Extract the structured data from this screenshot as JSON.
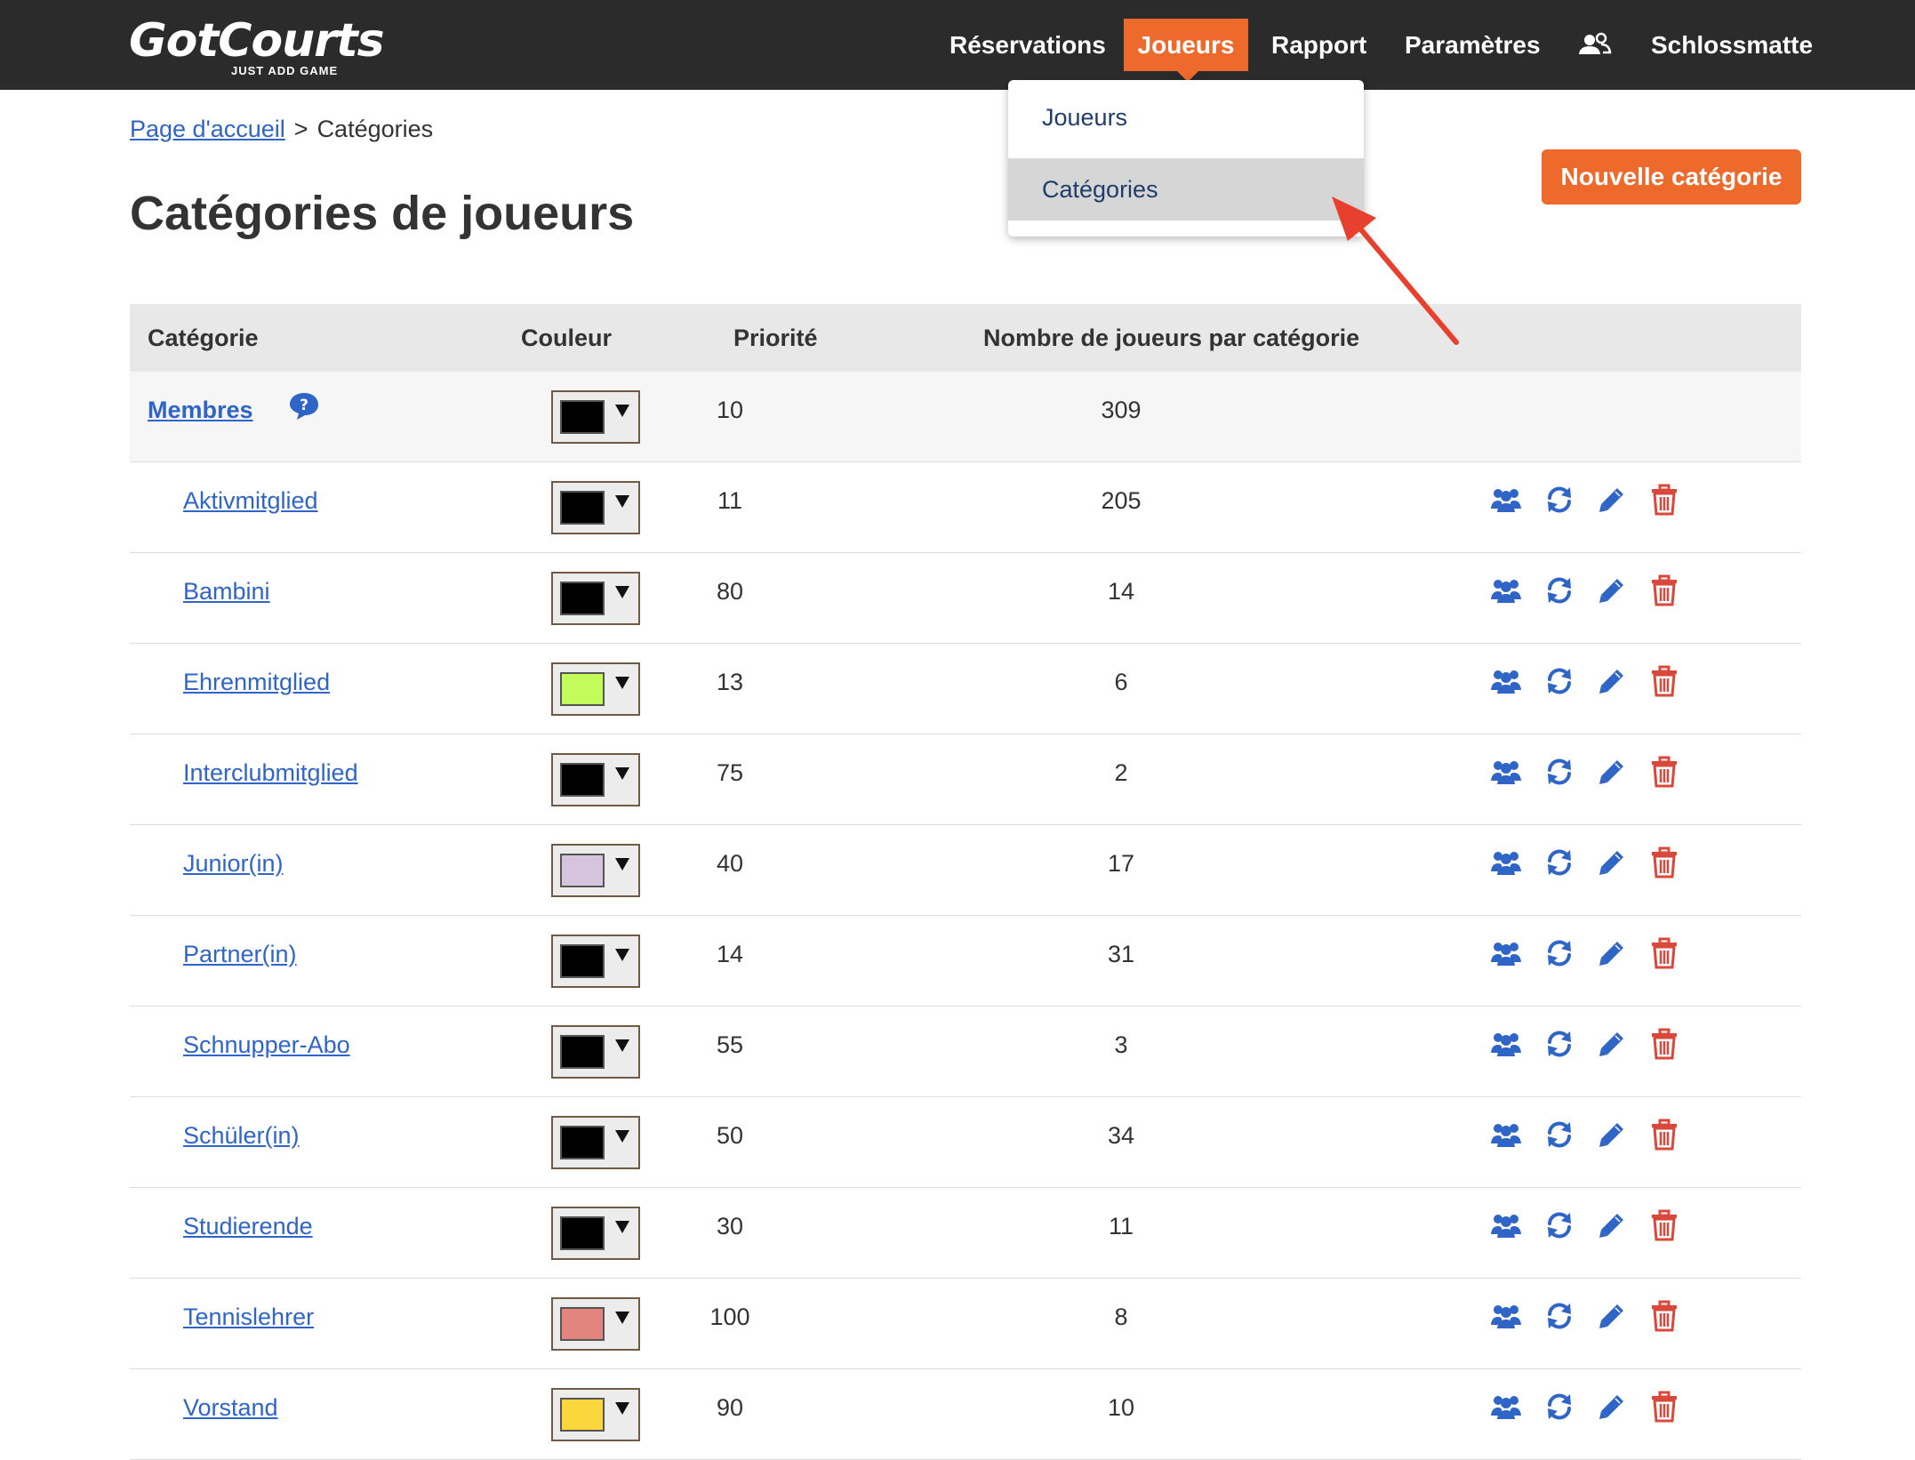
{
  "logo": {
    "name": "GotCourts",
    "tagline": "JUST ADD GAME"
  },
  "nav": {
    "reservations": "Réservations",
    "joueurs": "Joueurs",
    "rapport": "Rapport",
    "parametres": "Paramètres",
    "users_icon": "users-icon",
    "club": "Schlossmatte"
  },
  "dropdown": {
    "items": [
      {
        "label": "Joueurs"
      },
      {
        "label": "Catégories",
        "highlighted": true
      }
    ]
  },
  "breadcrumb": {
    "home": "Page d'accueil",
    "separator": ">",
    "current": "Catégories"
  },
  "page_title": "Catégories de joueurs",
  "new_button": "Nouvelle catégorie",
  "table": {
    "headers": {
      "category": "Catégorie",
      "color": "Couleur",
      "priority": "Priorité",
      "count": "Nombre de joueurs par catégorie"
    },
    "parent": {
      "name": "Membres",
      "color": "#000000",
      "priority": "10",
      "count": "309",
      "help_icon": "question-bubble-icon"
    },
    "rows": [
      {
        "name": "Aktivmitglied",
        "color": "#000000",
        "priority": "11",
        "count": "205"
      },
      {
        "name": "Bambini",
        "color": "#000000",
        "priority": "80",
        "count": "14"
      },
      {
        "name": "Ehrenmitglied",
        "color": "#c3fc5a",
        "priority": "13",
        "count": "6"
      },
      {
        "name": "Interclubmitglied",
        "color": "#000000",
        "priority": "75",
        "count": "2"
      },
      {
        "name": "Junior(in)",
        "color": "#d5c4dc",
        "priority": "40",
        "count": "17"
      },
      {
        "name": "Partner(in)",
        "color": "#000000",
        "priority": "14",
        "count": "31"
      },
      {
        "name": "Schnupper-Abo",
        "color": "#000000",
        "priority": "55",
        "count": "3"
      },
      {
        "name": "Schüler(in)",
        "color": "#000000",
        "priority": "50",
        "count": "34"
      },
      {
        "name": "Studierende",
        "color": "#000000",
        "priority": "30",
        "count": "11"
      },
      {
        "name": "Tennislehrer",
        "color": "#e2857f",
        "priority": "100",
        "count": "8"
      },
      {
        "name": "Vorstand",
        "color": "#fbd63c",
        "priority": "90",
        "count": "10"
      }
    ],
    "action_icons": [
      "members-icon",
      "sync-icon",
      "edit-pencil-icon",
      "trash-icon"
    ]
  },
  "colors": {
    "accent": "#ee6a2c",
    "header_bg": "#2b2b2b",
    "link": "#2f65c7",
    "action_blue": "#2f65c7",
    "delete_red": "#d9483b",
    "annotation_arrow": "#e8402e"
  }
}
